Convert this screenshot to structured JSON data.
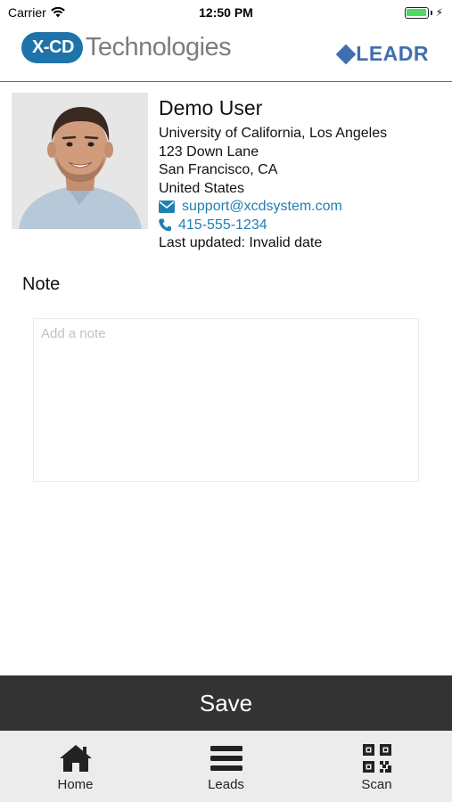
{
  "status_bar": {
    "carrier": "Carrier",
    "time": "12:50 PM"
  },
  "header": {
    "brand_left_badge": "X-CD",
    "brand_left_text": "Technologies",
    "brand_right_text": "LEADR"
  },
  "profile": {
    "name": "Demo User",
    "organization": "University of California, Los Angeles",
    "address_line1": "123 Down Lane",
    "address_line2": "San Francisco, CA",
    "country": "United States",
    "email": "support@xcdsystem.com",
    "phone": "415-555-1234",
    "last_updated": "Last updated: Invalid date"
  },
  "note": {
    "label": "Note",
    "placeholder": "Add a note",
    "value": ""
  },
  "save_button": {
    "label": "Save"
  },
  "tabs": [
    {
      "label": "Home",
      "icon": "home-icon"
    },
    {
      "label": "Leads",
      "icon": "menu-icon"
    },
    {
      "label": "Scan",
      "icon": "qr-code-icon"
    }
  ],
  "colors": {
    "accent": "#1f7fb3",
    "brand_blue": "#1e73a8",
    "leadr_blue": "#3f6fb0",
    "save_bar": "#333333",
    "tab_bar": "#ececec",
    "battery_green": "#4cd964"
  }
}
